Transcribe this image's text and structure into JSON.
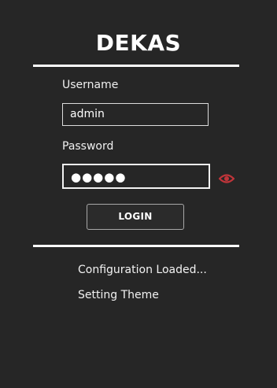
{
  "app": {
    "title": "DEKAS"
  },
  "form": {
    "username_label": "Username",
    "username_value": "admin",
    "password_label": "Password",
    "password_masked": "●●●●●",
    "login_label": "LOGIN",
    "reveal_icon": "eye-icon",
    "reveal_icon_color": "#c0353a"
  },
  "status": {
    "messages": [
      "Configuration Loaded...",
      "Setting Theme"
    ]
  },
  "colors": {
    "background": "#262626",
    "text": "#ffffff",
    "accent": "#c0353a"
  }
}
